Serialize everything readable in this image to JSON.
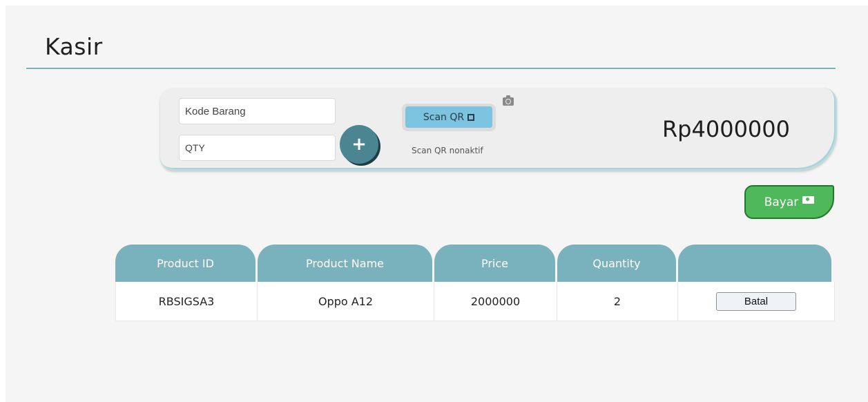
{
  "page": {
    "title": "Kasir"
  },
  "input_panel": {
    "kode_placeholder": "Kode Barang",
    "kode_value": "",
    "qty_placeholder": "QTY",
    "qty_value": "",
    "add_label": "+",
    "scan_label": "Scan QR",
    "scan_icon": "qr-scan-frame-icon",
    "camera_icon": "camera-icon",
    "scan_status": "Scan QR nonaktif",
    "total": "Rp4000000"
  },
  "actions": {
    "pay_label": "Bayar",
    "pay_icon": "money-bill-icon"
  },
  "table": {
    "headers": [
      "Product ID",
      "Product Name",
      "Price",
      "Quantity",
      ""
    ],
    "rows": [
      {
        "product_id": "RBSIGSA3",
        "product_name": "Oppo A12",
        "price": "2000000",
        "quantity": "2",
        "action_label": "Batal"
      }
    ]
  },
  "colors": {
    "accent_teal": "#79b2bc",
    "add_button": "#4c8592",
    "scan_button": "#7cc3e0",
    "pay_button": "#4fb85a",
    "pay_border": "#1c7a2d"
  }
}
